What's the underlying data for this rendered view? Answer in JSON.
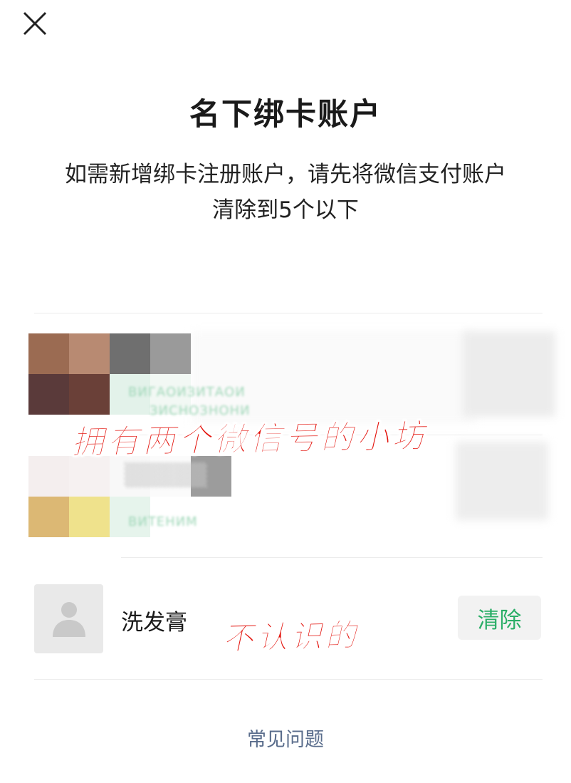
{
  "header": {
    "close_icon": "close-icon",
    "title": "名下绑卡账户",
    "description_line1": "如需新增绑卡注册账户，请先将微信支付账户",
    "description_line2": "清除到5个以下"
  },
  "accounts": [
    {
      "name": "",
      "obscured": true
    },
    {
      "name": "",
      "obscured": true
    },
    {
      "name": "洗发膏",
      "avatar_icon": "default-person-icon",
      "action_label": "清除"
    }
  ],
  "annotations": {
    "top": "拥有两个微信号的小坊",
    "bottom": "不认识的"
  },
  "footer": {
    "faq_label": "常见问题"
  },
  "colors": {
    "accent_green": "#2aae67",
    "annotation_red": "#e3120b",
    "link_blue_gray": "#5a6d8c"
  }
}
